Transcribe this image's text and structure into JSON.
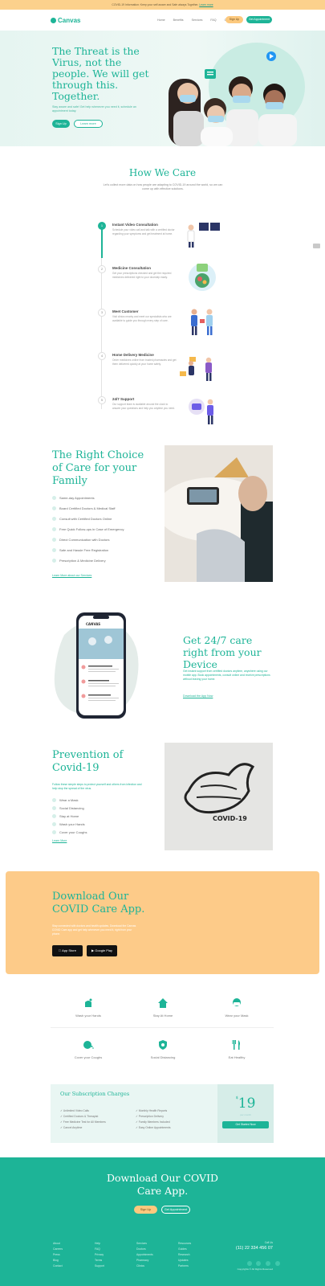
{
  "topbar": {
    "text": "COVID-19 Information: Keep your self aware and Safe always Together.",
    "link": "Learn more"
  },
  "nav": {
    "logo": "Canvas",
    "links": [
      "Home",
      "Benefits",
      "Services",
      "FAQ",
      "Contact"
    ],
    "signup": "Sign Up",
    "appointment": "Get Appointment"
  },
  "hero": {
    "title": "The Threat is the Virus, not the people. We will get through this. Together.",
    "subtitle": "Stay aware and safe! Get help whenever you need it, schedule an appointment today.",
    "btn_signup": "Sign Up",
    "btn_learn": "Learn more"
  },
  "how_we_care": {
    "title": "How We Care",
    "desc": "Let's collect more data on how people are adapting to COVID-19 around the world, so we can come up with effective solutions.",
    "steps": [
      {
        "num": "1",
        "title": "Instant Video Consultation",
        "text": "Schedule your video call and talk with a certified doctor regarding your symptoms and get treatment at home."
      },
      {
        "num": "2",
        "title": "Medicine Consultation",
        "text": "Get your prescriptions checked and get the required medicines delivered right to your doorstep easily."
      },
      {
        "num": "3",
        "title": "Meet Customer",
        "text": "Visit clinics nearby and meet our specialists who are available to guide you through every step of care."
      },
      {
        "num": "4",
        "title": "Home Delivery Medicine",
        "text": "Order medicines online from trusted pharmacies and get them delivered quickly at your home safely."
      },
      {
        "num": "5",
        "title": "24/7 Support",
        "text": "Our support team is available around the clock to answer your questions and help you anytime you need."
      }
    ]
  },
  "right_choice": {
    "title": "The Right Choice of Care for your Family",
    "items": [
      "Same-day Appointments",
      "Board Certified Doctors & Medical Staff",
      "Consult with Certified Doctors Online",
      "Free Quick Follow-ups in Case of Emergency",
      "Direct Communication with Doctors",
      "Safe and Hassle Free Registration",
      "Prescription & Medicine Delivery"
    ],
    "link": "Learn More about our Services"
  },
  "device": {
    "title": "Get 24/7 care right from your Device",
    "text": "Get instant support from certified doctors anytime, anywhere using our mobile app. Book appointments, consult online and receive prescriptions without leaving your home.",
    "link": "Download the App Now",
    "phone_brand": "CANVAS"
  },
  "prevention": {
    "title": "Prevention of Covid-19",
    "text": "Follow these simple steps to protect yourself and others from infection and help stop the spread of the virus.",
    "items": [
      "Wear a Mask",
      "Social Distancing",
      "Stay at Home",
      "Wash your Hands",
      "Cover your Coughs"
    ],
    "link": "Learn More",
    "mask_text": "COVID-19"
  },
  "download": {
    "title": "Download Our COVID Care App.",
    "text": "Stay connected with doctors and health updates. Download the Canvas COVID Care app and get help whenever you need it, right from your phone.",
    "appstore": "App Store",
    "googleplay": "Google Play"
  },
  "features": [
    {
      "label": "Wash your Hands",
      "icon": "hand-wash-icon"
    },
    {
      "label": "Stay At Home",
      "icon": "home-icon"
    },
    {
      "label": "Wear your Mask",
      "icon": "mask-icon"
    },
    {
      "label": "Cover your Coughs",
      "icon": "cough-icon"
    },
    {
      "label": "Social Distancing",
      "icon": "shield-icon"
    },
    {
      "label": "Eat Healthy",
      "icon": "cutlery-icon"
    }
  ],
  "subscription": {
    "title": "Our Subscription Charges",
    "left_items": [
      "Unlimited Video Calls",
      "Certified Doctors & Therapist",
      "Free Medicine Test for All Members",
      "Cancel Anytime"
    ],
    "right_items": [
      "Monthly Health Reports",
      "Prescription Delivery",
      "Family Members Included",
      "Easy Online Appointments"
    ],
    "currency": "$",
    "price": "19",
    "period": "per month",
    "button": "Get Started Now"
  },
  "footer": {
    "title": "Download Our COVID Care App.",
    "btn_signup": "Sign Up",
    "btn_appt": "Get Appointment",
    "columns": [
      [
        "About",
        "Careers",
        "Press",
        "Blog",
        "Contact"
      ],
      [
        "Help",
        "FAQ",
        "Privacy",
        "Terms",
        "Support"
      ],
      [
        "Services",
        "Doctors",
        "Appointments",
        "Pharmacy",
        "Clinics"
      ],
      [
        "Resources",
        "Guides",
        "Research",
        "Updates",
        "Partners"
      ]
    ],
    "call_label": "Call Us",
    "phone": "(11) 22 334 456 07",
    "copyright": "Copyrights © All Rights Reserved"
  },
  "colors": {
    "accent": "#1db497",
    "peach": "#fdcb89",
    "mint": "#e6f5f1"
  }
}
